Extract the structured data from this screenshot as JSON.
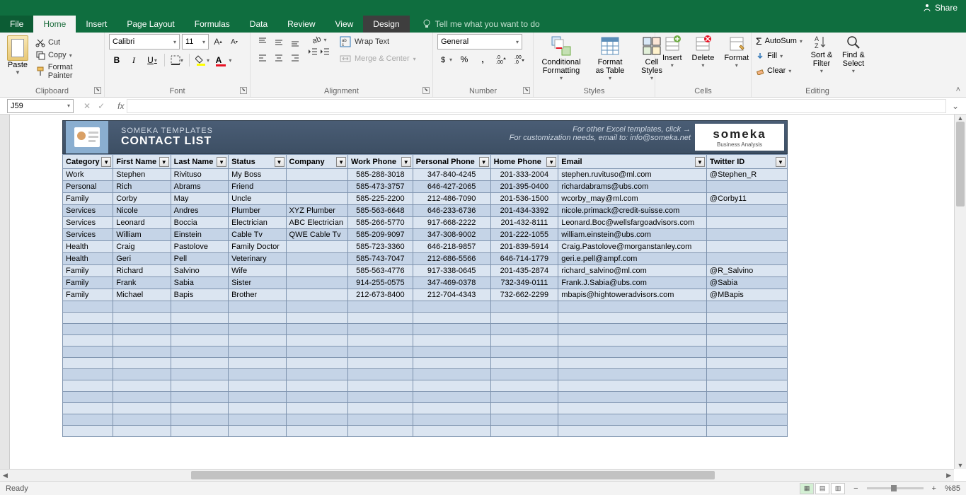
{
  "titlebar": {
    "share": "Share"
  },
  "tabs": {
    "file": "File",
    "home": "Home",
    "insert": "Insert",
    "page_layout": "Page Layout",
    "formulas": "Formulas",
    "data": "Data",
    "review": "Review",
    "view": "View",
    "design": "Design",
    "tell_me": "Tell me what you want to do"
  },
  "ribbon": {
    "clipboard": {
      "label": "Clipboard",
      "paste": "Paste",
      "cut": "Cut",
      "copy": "Copy",
      "format_painter": "Format Painter"
    },
    "font": {
      "label": "Font",
      "name": "Calibri",
      "size": "11"
    },
    "alignment": {
      "label": "Alignment",
      "wrap": "Wrap Text",
      "merge": "Merge & Center"
    },
    "number": {
      "label": "Number",
      "format": "General"
    },
    "styles": {
      "label": "Styles",
      "cond": "Conditional Formatting",
      "table": "Format as Table",
      "cell": "Cell Styles"
    },
    "cells": {
      "label": "Cells",
      "insert": "Insert",
      "delete": "Delete",
      "format": "Format"
    },
    "editing": {
      "label": "Editing",
      "autosum": "AutoSum",
      "fill": "Fill",
      "clear": "Clear",
      "sort": "Sort & Filter",
      "find": "Find & Select"
    }
  },
  "formula_bar": {
    "name_box": "J59"
  },
  "template": {
    "sub": "SOMEKA TEMPLATES",
    "title": "CONTACT LIST",
    "link1": "For other Excel templates, click →",
    "link2": "For customization needs, email to: info@someka.net",
    "logo_main": "someka",
    "logo_sub": "Business Analysis"
  },
  "columns": [
    "Category",
    "First Name",
    "Last Name",
    "Status",
    "Company",
    "Work Phone",
    "Personal Phone",
    "Home Phone",
    "Email",
    "Twitter ID"
  ],
  "rows": [
    [
      "Work",
      "Stephen",
      "Rivituso",
      "My Boss",
      "",
      "585-288-3018",
      "347-840-4245",
      "201-333-2004",
      "stephen.ruvituso@ml.com",
      "@Stephen_R"
    ],
    [
      "Personal",
      "Rich",
      "Abrams",
      "Friend",
      "",
      "585-473-3757",
      "646-427-2065",
      "201-395-0400",
      "richardabrams@ubs.com",
      ""
    ],
    [
      "Family",
      "Corby",
      "May",
      "Uncle",
      "",
      "585-225-2200",
      "212-486-7090",
      "201-536-1500",
      "wcorby_may@ml.com",
      "@Corby11"
    ],
    [
      "Services",
      "Nicole",
      "Andres",
      "Plumber",
      "XYZ Plumber",
      "585-563-6648",
      "646-233-6736",
      "201-434-3392",
      "nicole.primack@credit-suisse.com",
      ""
    ],
    [
      "Services",
      "Leonard",
      "Boccia",
      "Electrician",
      "ABC Electrician",
      "585-266-5770",
      "917-668-2222",
      "201-432-8111",
      "Leonard.Boc@wellsfargoadvisors.com",
      ""
    ],
    [
      "Services",
      "William",
      "Einstein",
      "Cable Tv",
      "QWE Cable Tv",
      "585-209-9097",
      "347-308-9002",
      "201-222-1055",
      "william.einstein@ubs.com",
      ""
    ],
    [
      "Health",
      "Craig",
      "Pastolove",
      "Family Doctor",
      "",
      "585-723-3360",
      "646-218-9857",
      "201-839-5914",
      "Craig.Pastolove@morganstanley.com",
      ""
    ],
    [
      "Health",
      "Geri",
      "Pell",
      "Veterinary",
      "",
      "585-743-7047",
      "212-686-5566",
      "646-714-1779",
      "geri.e.pell@ampf.com",
      ""
    ],
    [
      "Family",
      "Richard",
      "Salvino",
      "Wife",
      "",
      "585-563-4776",
      "917-338-0645",
      "201-435-2874",
      "richard_salvino@ml.com",
      "@R_Salvino"
    ],
    [
      "Family",
      "Frank",
      "Sabia",
      "Sister",
      "",
      "914-255-0575",
      "347-469-0378",
      "732-349-0111",
      "Frank.J.Sabia@ubs.com",
      "@Sabia"
    ],
    [
      "Family",
      "Michael",
      "Bapis",
      "Brother",
      "",
      "212-673-8400",
      "212-704-4343",
      "732-662-2299",
      "mbapis@hightoweradvisors.com",
      "@MBapis"
    ]
  ],
  "empty_rows": 12,
  "status": {
    "ready": "Ready",
    "zoom": "%85"
  }
}
